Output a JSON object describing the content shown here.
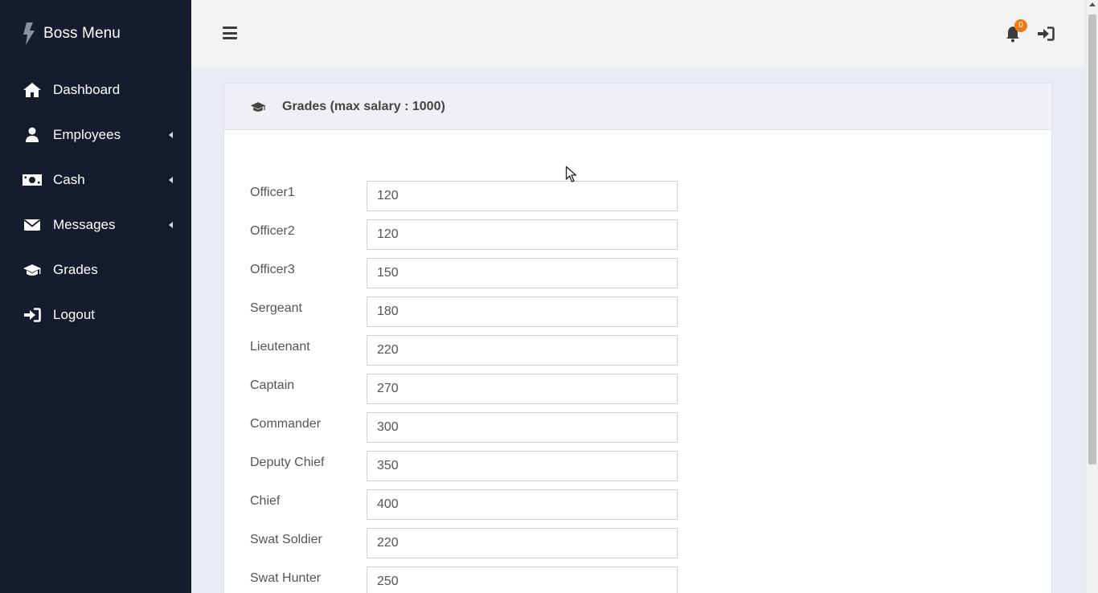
{
  "brand": {
    "title": "Boss Menu",
    "icon": "bolt-icon"
  },
  "sidebar": {
    "items": [
      {
        "label": "Dashboard",
        "icon": "home-icon",
        "has_submenu": false
      },
      {
        "label": "Employees",
        "icon": "user-icon",
        "has_submenu": true
      },
      {
        "label": "Cash",
        "icon": "money-icon",
        "has_submenu": true
      },
      {
        "label": "Messages",
        "icon": "envelope-icon",
        "has_submenu": true
      },
      {
        "label": "Grades",
        "icon": "graduation-cap-icon",
        "has_submenu": false
      },
      {
        "label": "Logout",
        "icon": "sign-in-icon",
        "has_submenu": false
      }
    ]
  },
  "topbar": {
    "notification_count": "0"
  },
  "card": {
    "title": "Grades (max salary : 1000)",
    "grades": [
      {
        "label": "Officer1",
        "value": "120"
      },
      {
        "label": "Officer2",
        "value": "120"
      },
      {
        "label": "Officer3",
        "value": "150"
      },
      {
        "label": "Sergeant",
        "value": "180"
      },
      {
        "label": "Lieutenant",
        "value": "220"
      },
      {
        "label": "Captain",
        "value": "270"
      },
      {
        "label": "Commander",
        "value": "300"
      },
      {
        "label": "Deputy Chief",
        "value": "350"
      },
      {
        "label": "Chief",
        "value": "400"
      },
      {
        "label": "Swat Soldier",
        "value": "220"
      },
      {
        "label": "Swat Hunter",
        "value": "250"
      }
    ]
  },
  "colors": {
    "sidebar_bg": "#161c2d",
    "badge": "#f07b16",
    "content_bg": "#e9ecf2"
  }
}
